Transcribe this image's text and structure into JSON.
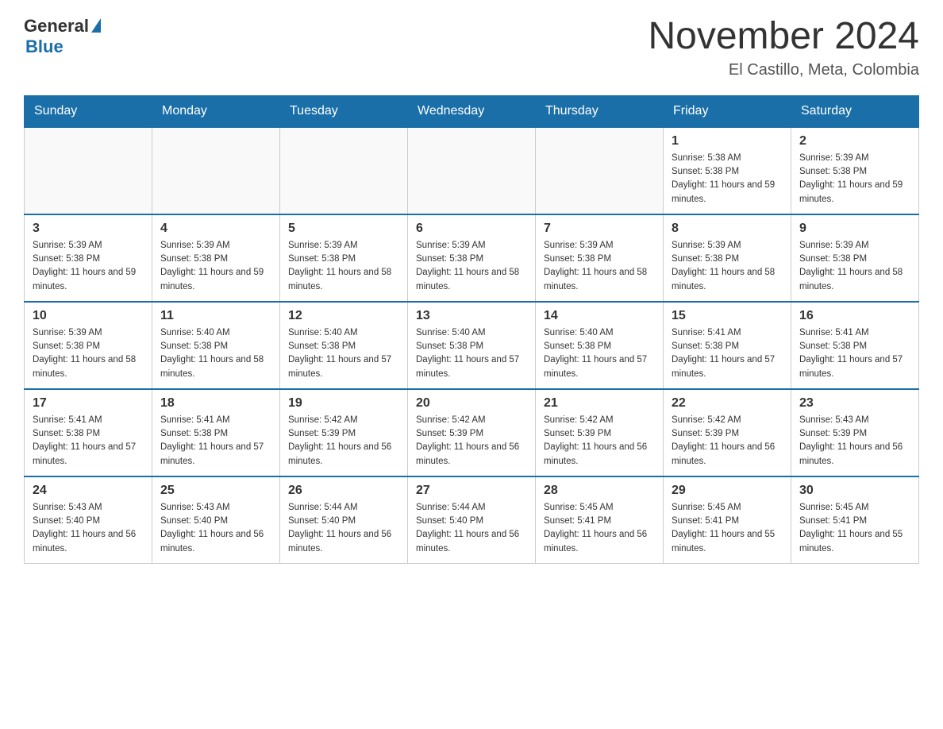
{
  "header": {
    "logo_general": "General",
    "logo_blue": "Blue",
    "month_title": "November 2024",
    "location": "El Castillo, Meta, Colombia"
  },
  "calendar": {
    "days_of_week": [
      "Sunday",
      "Monday",
      "Tuesday",
      "Wednesday",
      "Thursday",
      "Friday",
      "Saturday"
    ],
    "weeks": [
      [
        {
          "day": "",
          "info": ""
        },
        {
          "day": "",
          "info": ""
        },
        {
          "day": "",
          "info": ""
        },
        {
          "day": "",
          "info": ""
        },
        {
          "day": "",
          "info": ""
        },
        {
          "day": "1",
          "info": "Sunrise: 5:38 AM\nSunset: 5:38 PM\nDaylight: 11 hours and 59 minutes."
        },
        {
          "day": "2",
          "info": "Sunrise: 5:39 AM\nSunset: 5:38 PM\nDaylight: 11 hours and 59 minutes."
        }
      ],
      [
        {
          "day": "3",
          "info": "Sunrise: 5:39 AM\nSunset: 5:38 PM\nDaylight: 11 hours and 59 minutes."
        },
        {
          "day": "4",
          "info": "Sunrise: 5:39 AM\nSunset: 5:38 PM\nDaylight: 11 hours and 59 minutes."
        },
        {
          "day": "5",
          "info": "Sunrise: 5:39 AM\nSunset: 5:38 PM\nDaylight: 11 hours and 58 minutes."
        },
        {
          "day": "6",
          "info": "Sunrise: 5:39 AM\nSunset: 5:38 PM\nDaylight: 11 hours and 58 minutes."
        },
        {
          "day": "7",
          "info": "Sunrise: 5:39 AM\nSunset: 5:38 PM\nDaylight: 11 hours and 58 minutes."
        },
        {
          "day": "8",
          "info": "Sunrise: 5:39 AM\nSunset: 5:38 PM\nDaylight: 11 hours and 58 minutes."
        },
        {
          "day": "9",
          "info": "Sunrise: 5:39 AM\nSunset: 5:38 PM\nDaylight: 11 hours and 58 minutes."
        }
      ],
      [
        {
          "day": "10",
          "info": "Sunrise: 5:39 AM\nSunset: 5:38 PM\nDaylight: 11 hours and 58 minutes."
        },
        {
          "day": "11",
          "info": "Sunrise: 5:40 AM\nSunset: 5:38 PM\nDaylight: 11 hours and 58 minutes."
        },
        {
          "day": "12",
          "info": "Sunrise: 5:40 AM\nSunset: 5:38 PM\nDaylight: 11 hours and 57 minutes."
        },
        {
          "day": "13",
          "info": "Sunrise: 5:40 AM\nSunset: 5:38 PM\nDaylight: 11 hours and 57 minutes."
        },
        {
          "day": "14",
          "info": "Sunrise: 5:40 AM\nSunset: 5:38 PM\nDaylight: 11 hours and 57 minutes."
        },
        {
          "day": "15",
          "info": "Sunrise: 5:41 AM\nSunset: 5:38 PM\nDaylight: 11 hours and 57 minutes."
        },
        {
          "day": "16",
          "info": "Sunrise: 5:41 AM\nSunset: 5:38 PM\nDaylight: 11 hours and 57 minutes."
        }
      ],
      [
        {
          "day": "17",
          "info": "Sunrise: 5:41 AM\nSunset: 5:38 PM\nDaylight: 11 hours and 57 minutes."
        },
        {
          "day": "18",
          "info": "Sunrise: 5:41 AM\nSunset: 5:38 PM\nDaylight: 11 hours and 57 minutes."
        },
        {
          "day": "19",
          "info": "Sunrise: 5:42 AM\nSunset: 5:39 PM\nDaylight: 11 hours and 56 minutes."
        },
        {
          "day": "20",
          "info": "Sunrise: 5:42 AM\nSunset: 5:39 PM\nDaylight: 11 hours and 56 minutes."
        },
        {
          "day": "21",
          "info": "Sunrise: 5:42 AM\nSunset: 5:39 PM\nDaylight: 11 hours and 56 minutes."
        },
        {
          "day": "22",
          "info": "Sunrise: 5:42 AM\nSunset: 5:39 PM\nDaylight: 11 hours and 56 minutes."
        },
        {
          "day": "23",
          "info": "Sunrise: 5:43 AM\nSunset: 5:39 PM\nDaylight: 11 hours and 56 minutes."
        }
      ],
      [
        {
          "day": "24",
          "info": "Sunrise: 5:43 AM\nSunset: 5:40 PM\nDaylight: 11 hours and 56 minutes."
        },
        {
          "day": "25",
          "info": "Sunrise: 5:43 AM\nSunset: 5:40 PM\nDaylight: 11 hours and 56 minutes."
        },
        {
          "day": "26",
          "info": "Sunrise: 5:44 AM\nSunset: 5:40 PM\nDaylight: 11 hours and 56 minutes."
        },
        {
          "day": "27",
          "info": "Sunrise: 5:44 AM\nSunset: 5:40 PM\nDaylight: 11 hours and 56 minutes."
        },
        {
          "day": "28",
          "info": "Sunrise: 5:45 AM\nSunset: 5:41 PM\nDaylight: 11 hours and 56 minutes."
        },
        {
          "day": "29",
          "info": "Sunrise: 5:45 AM\nSunset: 5:41 PM\nDaylight: 11 hours and 55 minutes."
        },
        {
          "day": "30",
          "info": "Sunrise: 5:45 AM\nSunset: 5:41 PM\nDaylight: 11 hours and 55 minutes."
        }
      ]
    ]
  }
}
